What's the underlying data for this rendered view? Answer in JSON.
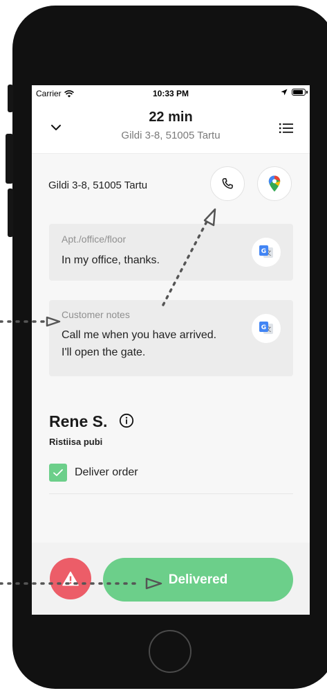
{
  "status_bar": {
    "carrier": "Carrier",
    "time": "10:33 PM"
  },
  "header": {
    "eta": "22 min",
    "address": "Gildi 3-8, 51005 Tartu"
  },
  "address_row": {
    "address": "Gildi 3-8, 51005 Tartu"
  },
  "apt_note": {
    "label": "Apt./office/floor",
    "text": "In my office, thanks."
  },
  "customer_note": {
    "label": "Customer notes",
    "line1": "Call me when you have arrived.",
    "line2": "I'll open the gate."
  },
  "customer": {
    "name": "Rene S.",
    "venue": "Ristiisa pubi"
  },
  "task": {
    "label": "Deliver order",
    "checked": true
  },
  "actions": {
    "delivered_label": "Delivered"
  },
  "colors": {
    "green": "#6ccf8a",
    "red": "#ec5d68",
    "card": "#ececec"
  },
  "icons": [
    "wifi-icon",
    "location-arrow-icon",
    "battery-icon",
    "chevron-down-icon",
    "list-menu-icon",
    "phone-icon",
    "maps-pin-icon",
    "translate-icon",
    "info-icon",
    "check-icon",
    "warning-icon"
  ]
}
